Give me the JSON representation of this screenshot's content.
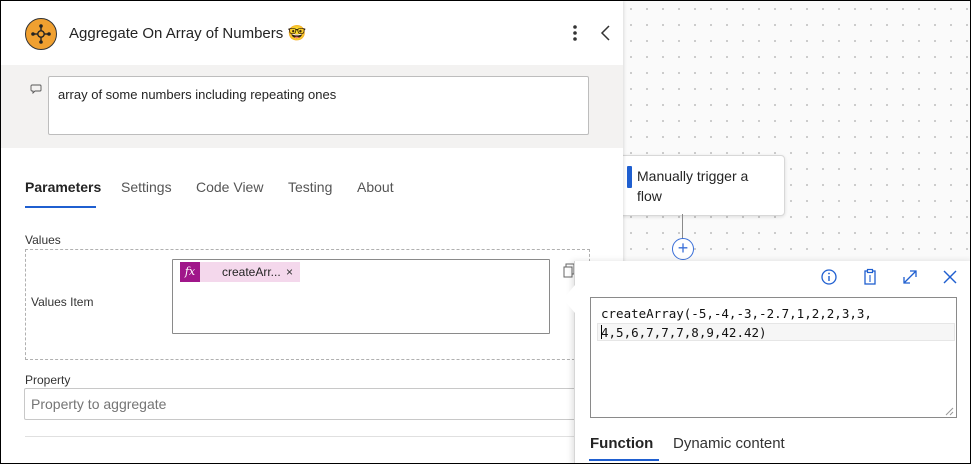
{
  "header": {
    "title": "Aggregate On Array of Numbers 🤓",
    "more_icon": "more-vertical-icon",
    "collapse_icon": "chevron-left-icon"
  },
  "description": {
    "value": "array of some numbers including repeating ones"
  },
  "tabs": [
    {
      "label": "Parameters",
      "active": true
    },
    {
      "label": "Settings"
    },
    {
      "label": "Code View"
    },
    {
      "label": "Testing"
    },
    {
      "label": "About"
    }
  ],
  "parameters": {
    "values_label": "Values",
    "values_item_label": "Values Item",
    "token": {
      "fx": "fx",
      "label": "createArr...",
      "remove": "×"
    },
    "property_label": "Property",
    "property_placeholder": "Property to aggregate"
  },
  "canvas": {
    "trigger_label": "Manually trigger a flow",
    "add_label": "+"
  },
  "expression_editor": {
    "lines": [
      "createArray(-5,-4,-3,-2.7,1,2,2,3,3,",
      "4,5,6,7,7,7,8,9,42.42)"
    ],
    "tabs": [
      {
        "label": "Function",
        "active": true
      },
      {
        "label": "Dynamic content"
      }
    ]
  },
  "colors": {
    "accent": "#1f5fd0",
    "token_bg": "#f4d8ec",
    "token_fx": "#a0168a",
    "app_icon": "#f0a030"
  }
}
